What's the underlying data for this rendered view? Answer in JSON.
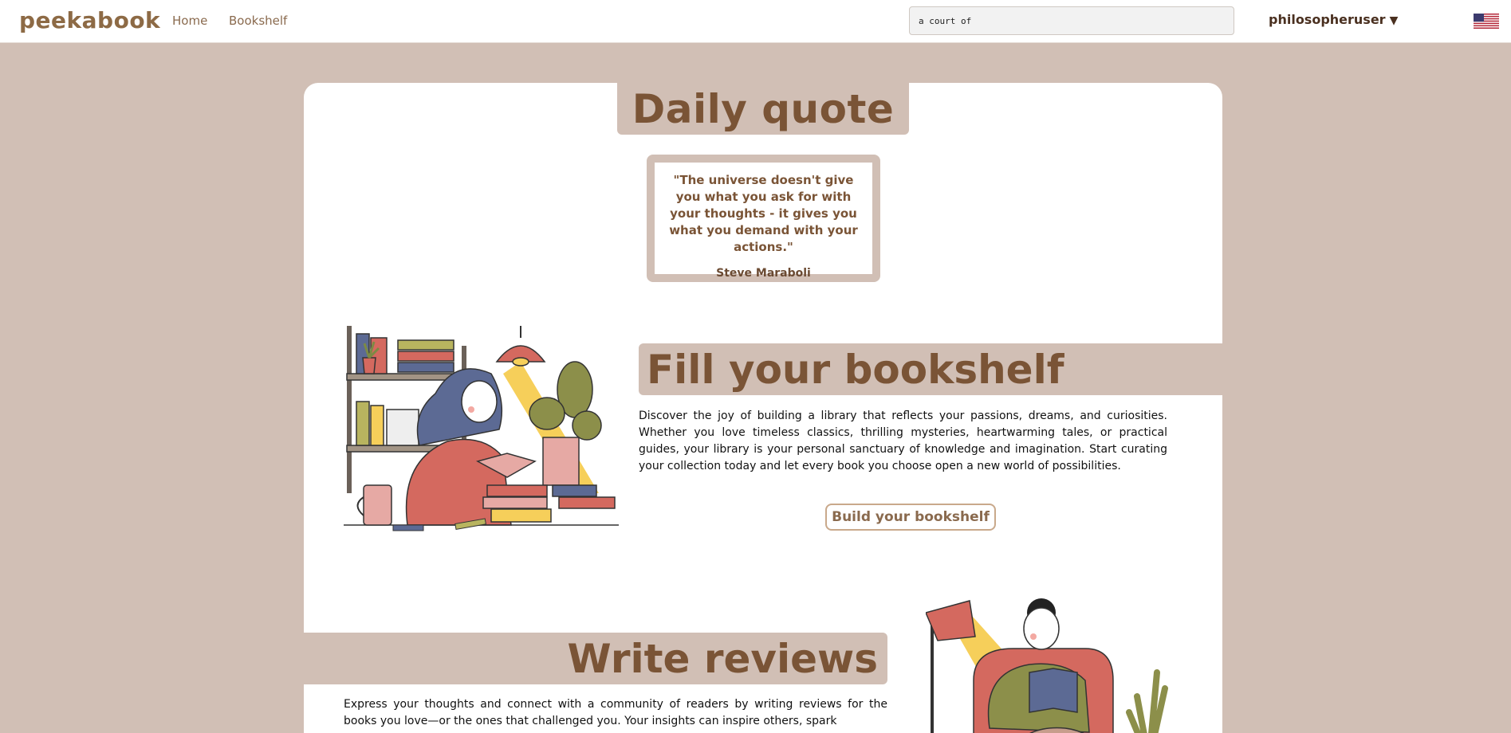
{
  "navbar": {
    "logo": "peekabook",
    "links": {
      "home": "Home",
      "bookshelf": "Bookshelf"
    },
    "search_value": "a court of",
    "username": "philosopheruser",
    "caret": "▼",
    "flag_icon": "us-flag-icon"
  },
  "daily_quote": {
    "heading": "Daily quote",
    "text": "\"The universe doesn't give you what you ask for with your thoughts - it gives you what you demand with your actions.\"",
    "author": "Steve Maraboli"
  },
  "fill_bookshelf": {
    "heading": "Fill your bookshelf",
    "body": "Discover the joy of building a library that reflects your passions, dreams, and curiosities. Whether you love timeless classics, thrilling mysteries, heartwarming tales, or practical guides, your library is your personal sanctuary of knowledge and imagination. Start curating your collection today and let every book you choose open a new world of possibilities.",
    "button_label": "Build your bookshelf"
  },
  "write_reviews": {
    "heading": "Write reviews",
    "body": "Express your thoughts and connect with a community of readers by writing reviews for the books you love—or the ones that challenged you. Your insights can inspire others, spark"
  },
  "colors": {
    "background": "#d1bfb5",
    "heading_brown": "#7a5436",
    "logo_brown": "#8d6a45",
    "card": "#ffffff"
  }
}
